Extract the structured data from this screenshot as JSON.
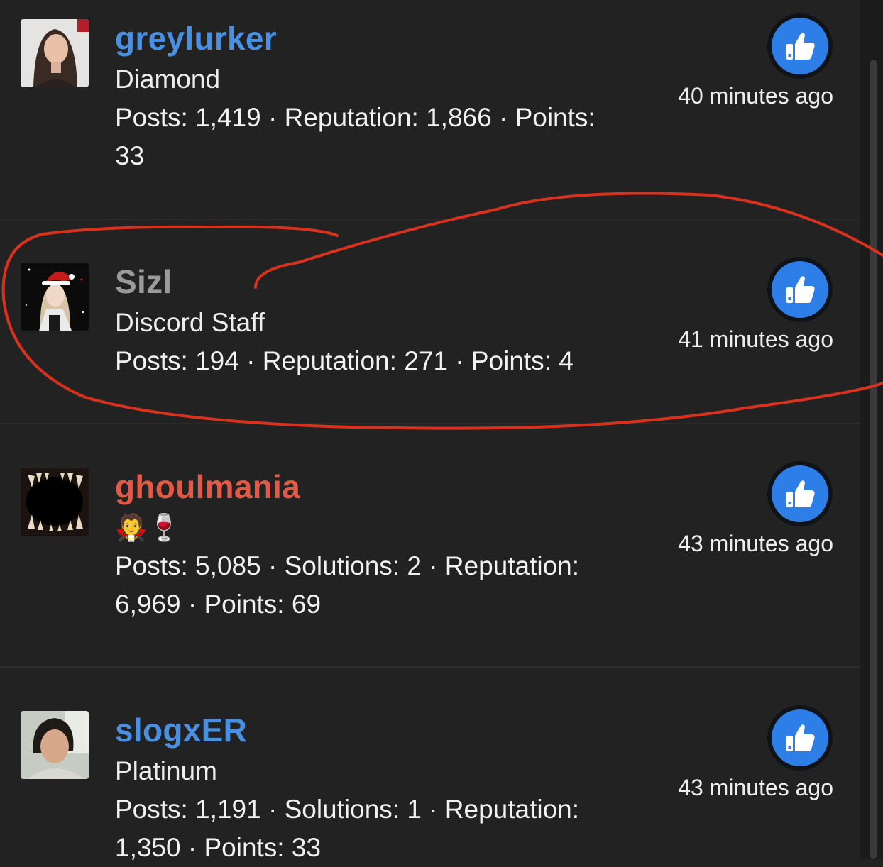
{
  "posts": [
    {
      "username": "greylurker",
      "username_color": "#4a90e2",
      "rank": "Diamond",
      "stats_line1": "Posts: 1,419 · Reputation: 1,866 · Points:",
      "stats_line2": "33",
      "time": "40 minutes ago"
    },
    {
      "username": "Sizl",
      "username_color": "#9a9a9a",
      "rank": "Discord Staff",
      "stats_line1": "Posts: 194 · Reputation: 271 · Points: 4",
      "time": "41 minutes ago"
    },
    {
      "username": "ghoulmania",
      "username_color": "#e05a47",
      "rank": "🧛🍷",
      "stats_line1": "Posts: 5,085 · Solutions: 2 · Reputation:",
      "stats_line2": "6,969 · Points: 69",
      "time": "43 minutes ago"
    },
    {
      "username": "slogxER",
      "username_color": "#4a90e2",
      "rank": "Platinum",
      "stats_line1": "Posts: 1,191 · Solutions: 1 · Reputation:",
      "stats_line2": "1,350 · Points: 33",
      "time": "43 minutes ago"
    }
  ],
  "icons": {
    "like": "thumbs-up-icon",
    "avatar": "user-avatar"
  },
  "colors": {
    "background": "#222222",
    "like_blue": "#2d7ee6",
    "annotation_red": "#d8321f"
  }
}
